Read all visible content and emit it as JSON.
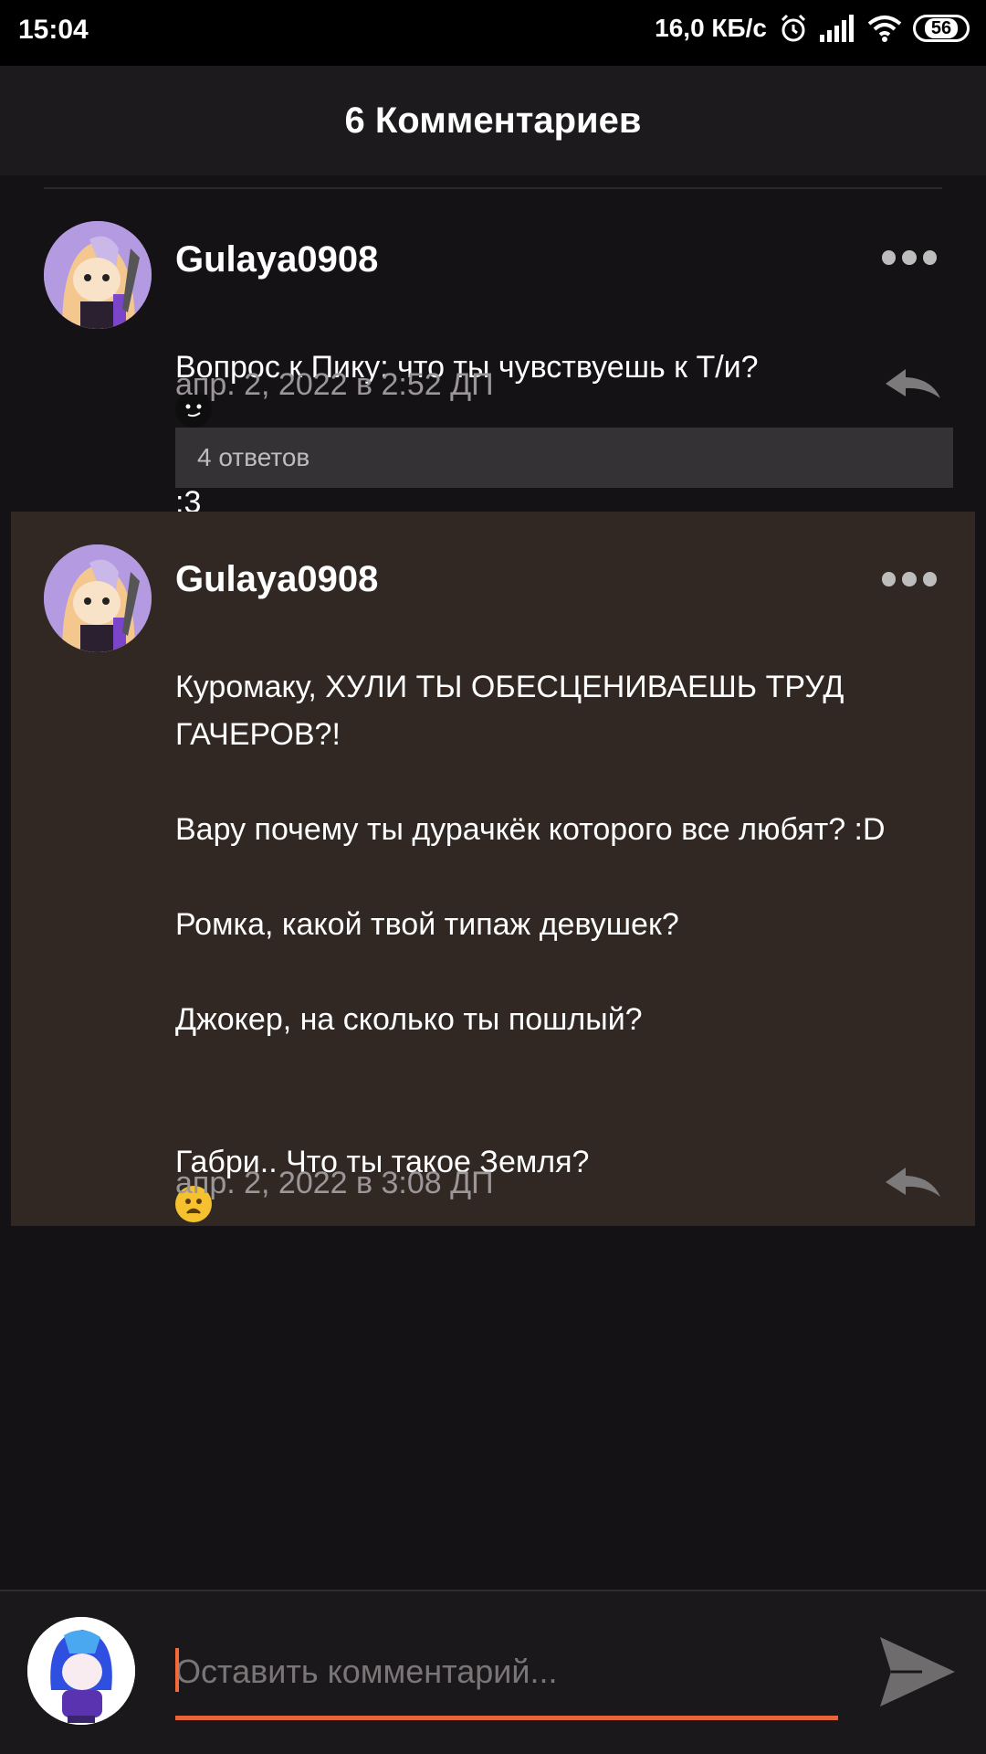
{
  "status_bar": {
    "time": "15:04",
    "network_speed": "16,0 КБ/с",
    "battery": "56"
  },
  "header": {
    "title": "6 Комментариев"
  },
  "comments": [
    {
      "username": "Gulaya0908",
      "text": "Вопрос к Пику: что ты чувствуешь к Т/и?",
      "text_suffix": ":3",
      "timestamp": "апр. 2, 2022 в 2:52 ДП",
      "replies_label": "4 ответов"
    },
    {
      "username": "Gulaya0908",
      "text": "Куромаку, ХУЛИ ТЫ ОБЕСЦЕНИВАЕШЬ ТРУД ГАЧЕРОВ?!\n\nВару почему ты дурачкёк которого все любят? :D\n\nРомка, какой твой типаж девушек?\n\nДжокер, на сколько ты пошлый?\n\n\nГабри.. Что ты такое Земля?",
      "timestamp": "апр. 2, 2022 в 3:08 ДП"
    }
  ],
  "composer": {
    "placeholder": "Оставить комментарий..."
  },
  "colors": {
    "accent": "#e8643a",
    "background": "#141214",
    "highlight": "#312824"
  }
}
